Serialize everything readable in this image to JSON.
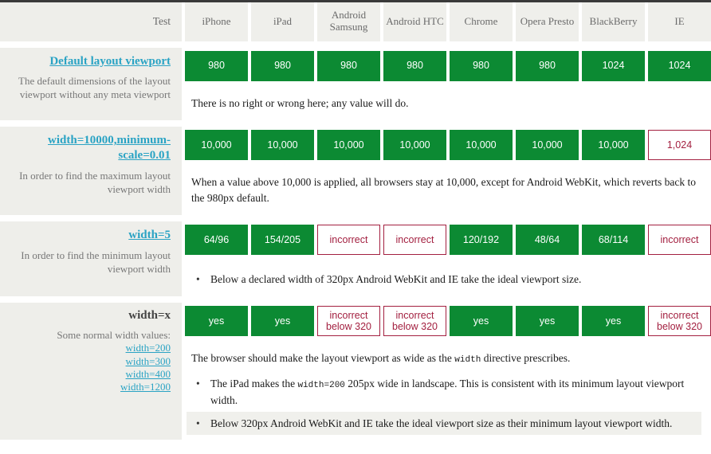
{
  "table": {
    "columns": [
      "Test",
      "iPhone",
      "iPad",
      "Android Samsung",
      "Android HTC",
      "Chrome",
      "Opera Presto",
      "BlackBerry",
      "IE"
    ],
    "colors": {
      "ok_bg": "#0c8a33",
      "ok_text": "#ffffff",
      "bad_border": "#a32040",
      "bad_text": "#a32040",
      "link": "#2aa3c4",
      "label_bg": "#eeeeea",
      "header_bg": "#efefeb",
      "muted_text": "#777777"
    },
    "rows": [
      {
        "title": "Default layout viewport",
        "title_is_link": true,
        "description": "The default dimensions of the layout viewport without any meta viewport",
        "cells": [
          {
            "value": "980",
            "state": "ok"
          },
          {
            "value": "980",
            "state": "ok"
          },
          {
            "value": "980",
            "state": "ok"
          },
          {
            "value": "980",
            "state": "ok"
          },
          {
            "value": "980",
            "state": "ok"
          },
          {
            "value": "980",
            "state": "ok"
          },
          {
            "value": "1024",
            "state": "ok"
          },
          {
            "value": "1024",
            "state": "ok"
          }
        ],
        "note": "There is no right or wrong here; any value will do.",
        "bullets": []
      },
      {
        "title": "width=10000,minimum-scale=0.01",
        "title_is_link": true,
        "description": "In order to find the maximum layout viewport width",
        "cells": [
          {
            "value": "10,000",
            "state": "ok"
          },
          {
            "value": "10,000",
            "state": "ok"
          },
          {
            "value": "10,000",
            "state": "ok"
          },
          {
            "value": "10,000",
            "state": "ok"
          },
          {
            "value": "10,000",
            "state": "ok"
          },
          {
            "value": "10,000",
            "state": "ok"
          },
          {
            "value": "10,000",
            "state": "ok"
          },
          {
            "value": "1,024",
            "state": "bad"
          }
        ],
        "note": "When a value above 10,000 is applied, all browsers stay at 10,000, except for Android WebKit, which reverts back to the 980px default.",
        "bullets": []
      },
      {
        "title": "width=5",
        "title_is_link": true,
        "description": "In order to find the minimum layout viewport width",
        "cells": [
          {
            "value": "64/96",
            "state": "ok"
          },
          {
            "value": "154/205",
            "state": "ok"
          },
          {
            "value": "incorrect",
            "state": "bad"
          },
          {
            "value": "incorrect",
            "state": "bad"
          },
          {
            "value": "120/192",
            "state": "ok"
          },
          {
            "value": "48/64",
            "state": "ok"
          },
          {
            "value": "68/114",
            "state": "ok"
          },
          {
            "value": "incorrect",
            "state": "bad"
          }
        ],
        "note": "",
        "bullets": [
          {
            "text": "Below a declared width of 320px Android WebKit and IE take the ideal viewport size.",
            "shaded": false
          }
        ]
      },
      {
        "title": "width=x",
        "title_is_link": false,
        "description": "Some normal width values:",
        "sub_links": [
          "width=200",
          "width=300",
          "width=400",
          "width=1200"
        ],
        "cells": [
          {
            "value": "yes",
            "state": "ok"
          },
          {
            "value": "yes",
            "state": "ok"
          },
          {
            "value": "incorrect below 320",
            "state": "bad"
          },
          {
            "value": "incorrect below 320",
            "state": "bad"
          },
          {
            "value": "yes",
            "state": "ok"
          },
          {
            "value": "yes",
            "state": "ok"
          },
          {
            "value": "yes",
            "state": "ok"
          },
          {
            "value": "incorrect below 320",
            "state": "bad"
          }
        ],
        "note": "The browser should make the layout viewport as wide as the width directive prescribes.",
        "note_code": "width",
        "bullets": [
          {
            "text": "The iPad makes the width=200 205px wide in landscape. This is consistent with its minimum layout viewport width.",
            "shaded": false,
            "code": "width=200"
          },
          {
            "text": "Below 320px Android WebKit and IE take the ideal viewport size as their minimum layout viewport width.",
            "shaded": true
          }
        ]
      }
    ]
  }
}
